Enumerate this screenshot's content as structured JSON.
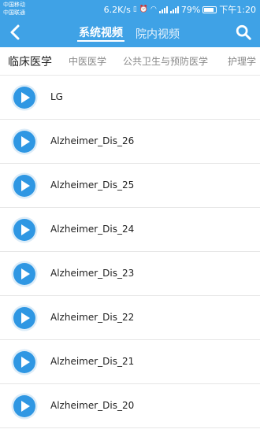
{
  "status": {
    "carrier1": "中国移动",
    "carrier2": "中国联通",
    "speed": "6.2K/s",
    "battery": "79%",
    "time": "下午1:20",
    "icons": [
      "vibrate-icon",
      "alarm-icon",
      "wifi-icon",
      "signal-icon",
      "battery-icon"
    ]
  },
  "header": {
    "back_icon": "chevron-left-icon",
    "tab_system": "系统视频",
    "tab_hospital": "院内视频",
    "search_icon": "search-icon",
    "color": "#3fa2e6"
  },
  "categories": [
    "临床医学",
    "中医医学",
    "公共卫生与预防医学",
    "护理学"
  ],
  "videos": [
    "LG",
    "Alzheimer_Dis_26",
    "Alzheimer_Dis_25",
    "Alzheimer_Dis_24",
    "Alzheimer_Dis_23",
    "Alzheimer_Dis_22",
    "Alzheimer_Dis_21",
    "Alzheimer_Dis_20"
  ]
}
